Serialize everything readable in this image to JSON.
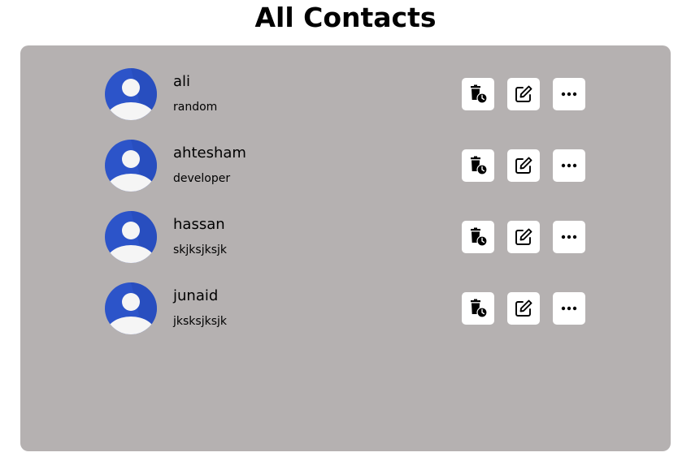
{
  "header": {
    "title": "All Contacts"
  },
  "contacts": [
    {
      "name": "ali",
      "description": "random"
    },
    {
      "name": "ahtesham",
      "description": "developer"
    },
    {
      "name": "hassan",
      "description": "skjksjksjk"
    },
    {
      "name": "junaid",
      "description": "jksksjksjk"
    }
  ],
  "actions": {
    "delete_icon": "trash-clock-icon",
    "edit_icon": "edit-icon",
    "more_icon": "more-dots-icon"
  },
  "colors": {
    "panel_background": "#b5b1b1",
    "avatar_blue": "#2c54c9",
    "avatar_figure": "#f5f5f5",
    "button_background": "#ffffff"
  }
}
